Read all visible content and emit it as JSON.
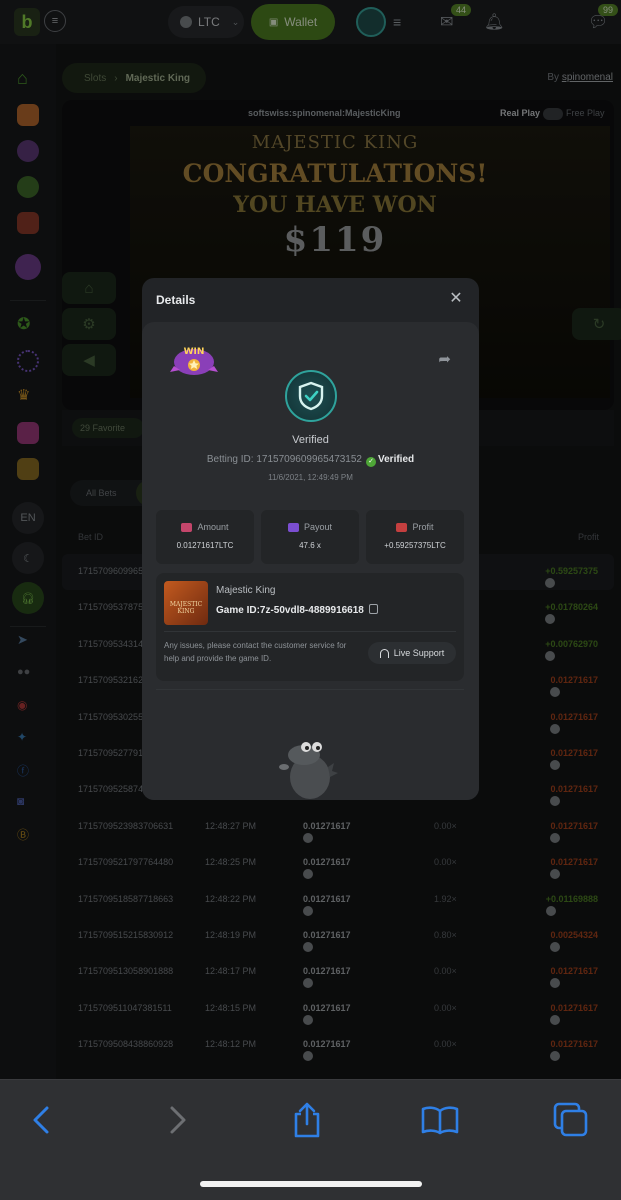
{
  "topbar": {
    "currency": "LTC",
    "wallet_label": "Wallet",
    "mail_badge": "44",
    "chat_badge": "99"
  },
  "sidebar": {
    "language": "EN"
  },
  "page": {
    "breadcrumb_root": "Slots",
    "breadcrumb_current": "Majestic King",
    "by_label": "By",
    "provider": "spinomenal",
    "game_source": "softswiss:spinomenal:MajesticKing",
    "real_play": "Real Play",
    "free_play": "Free Play",
    "favorite": "29 Favorite",
    "tab_all": "All Bets",
    "col_betid": "Bet ID",
    "col_profit": "Profit"
  },
  "game": {
    "banner_line1": "MAJESTIC KING",
    "banner_line2": "CONGRATULATIONS!",
    "banner_line3": "YOU HAVE WON",
    "banner_amount": "$119"
  },
  "bets": [
    {
      "id": "1715709609965",
      "time": "",
      "amount": "",
      "mult": "",
      "profit": "+0.59257375",
      "sign": "pos"
    },
    {
      "id": "1715709537875",
      "time": "",
      "amount": "",
      "mult": "",
      "profit": "+0.01780264",
      "sign": "pos"
    },
    {
      "id": "1715709534314",
      "time": "",
      "amount": "",
      "mult": "",
      "profit": "+0.00762970",
      "sign": "pos"
    },
    {
      "id": "1715709532162",
      "time": "",
      "amount": "",
      "mult": "",
      "profit": "0.01271617",
      "sign": "neg"
    },
    {
      "id": "1715709530255",
      "time": "",
      "amount": "",
      "mult": "",
      "profit": "0.01271617",
      "sign": "neg"
    },
    {
      "id": "1715709527791",
      "time": "",
      "amount": "",
      "mult": "",
      "profit": "0.01271617",
      "sign": "neg"
    },
    {
      "id": "1715709525874",
      "time": "",
      "amount": "",
      "mult": "",
      "profit": "0.01271617",
      "sign": "neg"
    },
    {
      "id": "1715709523983706631",
      "time": "12:48:27 PM",
      "amount": "0.01271617",
      "mult": "0.00×",
      "profit": "0.01271617",
      "sign": "neg"
    },
    {
      "id": "1715709521797764480",
      "time": "12:48:25 PM",
      "amount": "0.01271617",
      "mult": "0.00×",
      "profit": "0.01271617",
      "sign": "neg"
    },
    {
      "id": "1715709518587718663",
      "time": "12:48:22 PM",
      "amount": "0.01271617",
      "mult": "1.92×",
      "profit": "+0.01169888",
      "sign": "pos"
    },
    {
      "id": "1715709515215830912",
      "time": "12:48:19 PM",
      "amount": "0.01271617",
      "mult": "0.80×",
      "profit": "0.00254324",
      "sign": "neg"
    },
    {
      "id": "1715709513058901888",
      "time": "12:48:17 PM",
      "amount": "0.01271617",
      "mult": "0.00×",
      "profit": "0.01271617",
      "sign": "neg"
    },
    {
      "id": "1715709511047381511",
      "time": "12:48:15 PM",
      "amount": "0.01271617",
      "mult": "0.00×",
      "profit": "0.01271617",
      "sign": "neg"
    },
    {
      "id": "1715709508438860928",
      "time": "12:48:12 PM",
      "amount": "0.01271617",
      "mult": "0.00×",
      "profit": "0.01271617",
      "sign": "neg"
    }
  ],
  "modal": {
    "title": "Details",
    "verified_label": "Verified",
    "betting_id_label": "Betting ID: 1715709609965473152",
    "verified_badge": "Verified",
    "date": "11/6/2021, 12:49:49 PM",
    "win_text": "WIN",
    "amount_label": "Amount",
    "amount_value": "0.01271617LTC",
    "payout_label": "Payout",
    "payout_value": "47.6 x",
    "profit_label": "Profit",
    "profit_value": "+0.59257375LTC",
    "game_name": "Majestic King",
    "game_id": "Game ID:7z-50vdl8-4889916618",
    "thumb_text": "MAJESTIC KING",
    "note": "Any issues, please contact the customer service for help and provide the game ID.",
    "support_label": "Live Support"
  },
  "colors": {
    "accent_green": "#4f7f22",
    "profit_positive": "#4d7f24",
    "profit_negative": "#a5421d",
    "verified_green": "#4ea637",
    "browser_icon_blue": "#2f7fe6"
  }
}
